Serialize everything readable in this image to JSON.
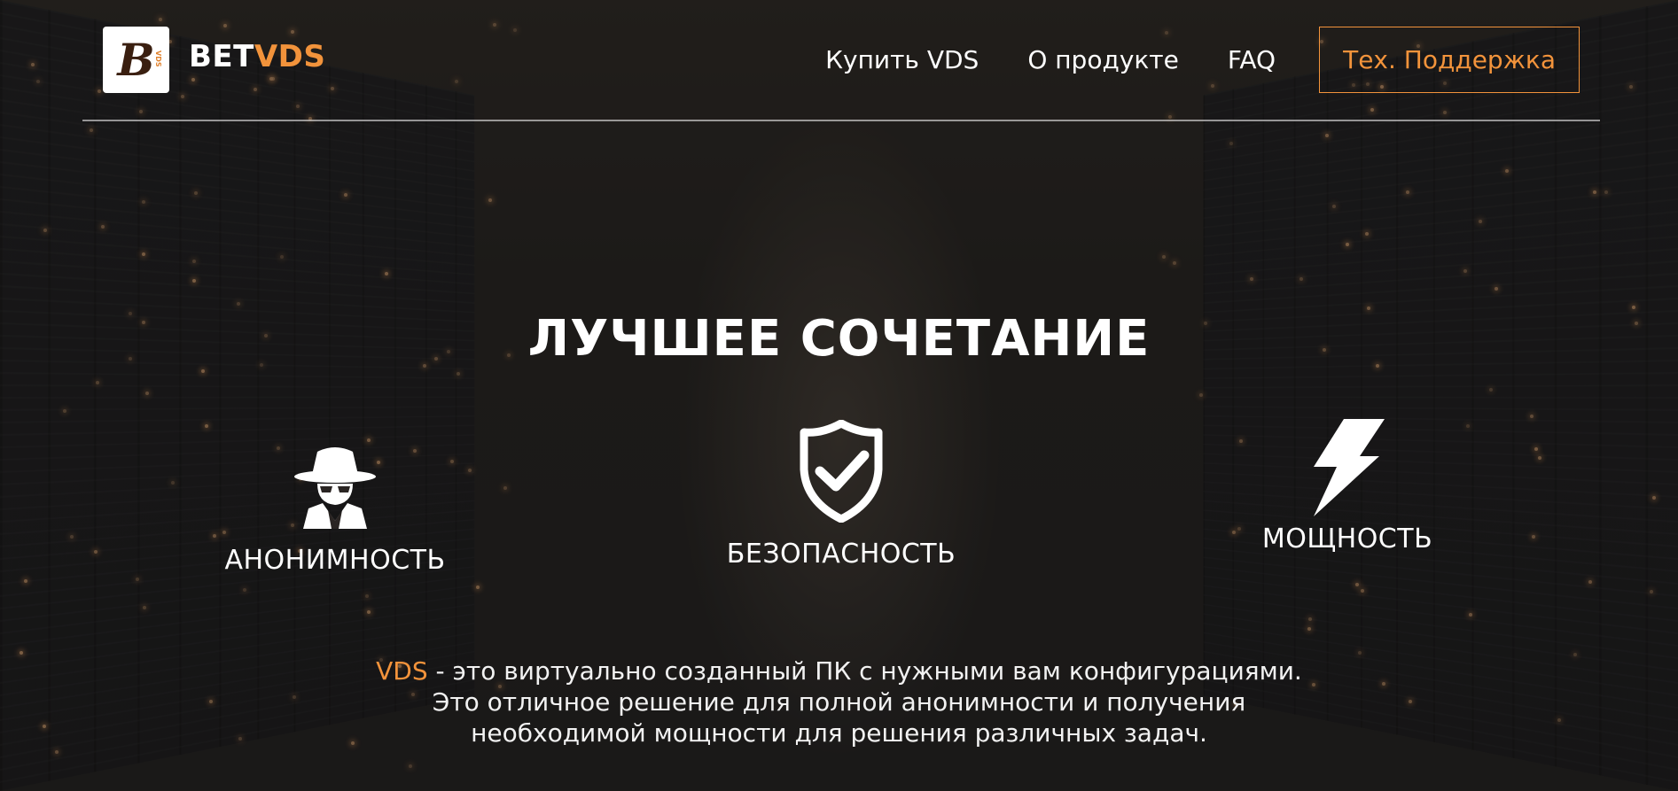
{
  "brand": {
    "logo_letter": "B",
    "logo_tag": "VDS",
    "name_part1": "BET",
    "name_part2": "VDS"
  },
  "nav": {
    "items": [
      {
        "label": "Купить VDS"
      },
      {
        "label": "О продукте"
      },
      {
        "label": "FAQ"
      }
    ],
    "support_label": "Тех. Поддержка"
  },
  "hero": {
    "title": "ЛУЧШЕЕ СОЧЕТАНИЕ",
    "features": [
      {
        "label": "АНОНИМНОСТЬ",
        "icon": "spy-icon"
      },
      {
        "label": "БЕЗОПАСНОСТЬ",
        "icon": "shield-check-icon"
      },
      {
        "label": "МОЩНОСТЬ",
        "icon": "lightning-icon"
      }
    ],
    "description": {
      "accent": "VDS",
      "line1": " - это виртуально созданный ПК с нужными вам конфигурациями.",
      "line2": "Это отличное решение для полной анонимности и получения",
      "line3": "необходимой мощности для решения различных задач."
    }
  },
  "colors": {
    "accent": "#f2933b",
    "text": "#ffffff"
  }
}
